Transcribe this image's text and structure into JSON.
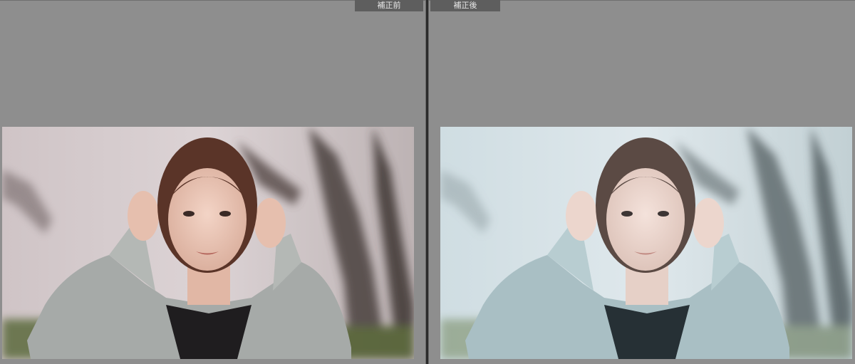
{
  "compare": {
    "before_label": "補正前",
    "after_label": "補正後"
  },
  "icons": {
    "before_photo": "portrait-photo-icon",
    "after_photo": "portrait-photo-icon"
  },
  "colors": {
    "background": "#8e8e8e",
    "divider": "#2b2b2b",
    "label_bg": "#5e5e5e",
    "label_text": "#e8e8e8"
  }
}
